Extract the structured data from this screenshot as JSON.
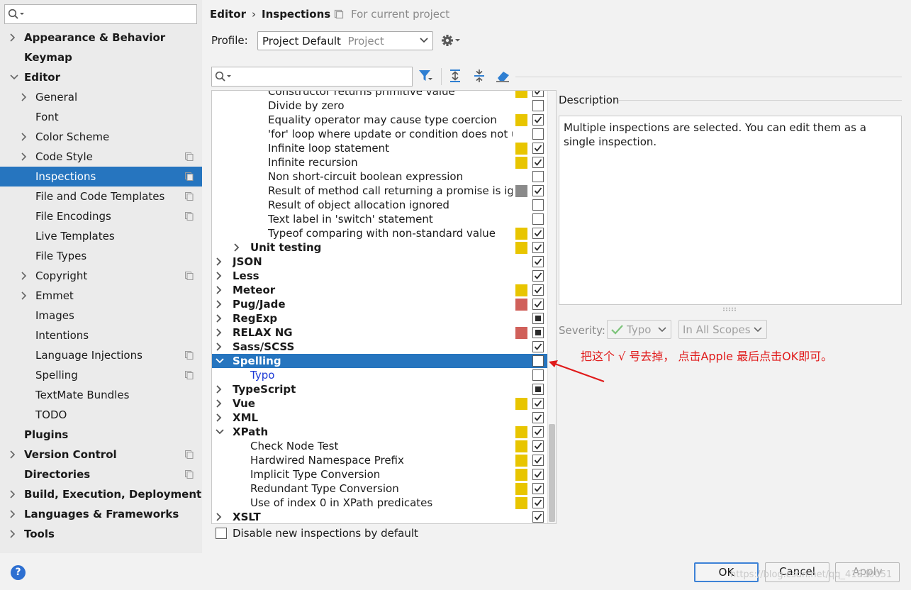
{
  "sidebar": {
    "search": {
      "value": "",
      "placeholder": ""
    },
    "items": [
      {
        "label": "Appearance & Behavior",
        "level": 0,
        "bold": true,
        "expander": "collapsed",
        "proj": false,
        "selected": false
      },
      {
        "label": "Keymap",
        "level": 0,
        "bold": true,
        "expander": "none",
        "proj": false,
        "selected": false
      },
      {
        "label": "Editor",
        "level": 0,
        "bold": true,
        "expander": "expanded",
        "proj": false,
        "selected": false
      },
      {
        "label": "General",
        "level": 1,
        "bold": false,
        "expander": "collapsed",
        "proj": false,
        "selected": false
      },
      {
        "label": "Font",
        "level": 1,
        "bold": false,
        "expander": "none",
        "proj": false,
        "selected": false
      },
      {
        "label": "Color Scheme",
        "level": 1,
        "bold": false,
        "expander": "collapsed",
        "proj": false,
        "selected": false
      },
      {
        "label": "Code Style",
        "level": 1,
        "bold": false,
        "expander": "collapsed",
        "proj": true,
        "selected": false
      },
      {
        "label": "Inspections",
        "level": 1,
        "bold": false,
        "expander": "none",
        "proj": true,
        "selected": true
      },
      {
        "label": "File and Code Templates",
        "level": 1,
        "bold": false,
        "expander": "none",
        "proj": true,
        "selected": false
      },
      {
        "label": "File Encodings",
        "level": 1,
        "bold": false,
        "expander": "none",
        "proj": true,
        "selected": false
      },
      {
        "label": "Live Templates",
        "level": 1,
        "bold": false,
        "expander": "none",
        "proj": false,
        "selected": false
      },
      {
        "label": "File Types",
        "level": 1,
        "bold": false,
        "expander": "none",
        "proj": false,
        "selected": false
      },
      {
        "label": "Copyright",
        "level": 1,
        "bold": false,
        "expander": "collapsed",
        "proj": true,
        "selected": false
      },
      {
        "label": "Emmet",
        "level": 1,
        "bold": false,
        "expander": "collapsed",
        "proj": false,
        "selected": false
      },
      {
        "label": "Images",
        "level": 1,
        "bold": false,
        "expander": "none",
        "proj": false,
        "selected": false
      },
      {
        "label": "Intentions",
        "level": 1,
        "bold": false,
        "expander": "none",
        "proj": false,
        "selected": false
      },
      {
        "label": "Language Injections",
        "level": 1,
        "bold": false,
        "expander": "none",
        "proj": true,
        "selected": false
      },
      {
        "label": "Spelling",
        "level": 1,
        "bold": false,
        "expander": "none",
        "proj": true,
        "selected": false
      },
      {
        "label": "TextMate Bundles",
        "level": 1,
        "bold": false,
        "expander": "none",
        "proj": false,
        "selected": false
      },
      {
        "label": "TODO",
        "level": 1,
        "bold": false,
        "expander": "none",
        "proj": false,
        "selected": false
      },
      {
        "label": "Plugins",
        "level": 0,
        "bold": true,
        "expander": "none",
        "proj": false,
        "selected": false
      },
      {
        "label": "Version Control",
        "level": 0,
        "bold": true,
        "expander": "collapsed",
        "proj": true,
        "selected": false
      },
      {
        "label": "Directories",
        "level": 0,
        "bold": true,
        "expander": "none",
        "proj": true,
        "selected": false
      },
      {
        "label": "Build, Execution, Deployment",
        "level": 0,
        "bold": true,
        "expander": "collapsed",
        "proj": false,
        "selected": false
      },
      {
        "label": "Languages & Frameworks",
        "level": 0,
        "bold": true,
        "expander": "collapsed",
        "proj": false,
        "selected": false
      },
      {
        "label": "Tools",
        "level": 0,
        "bold": true,
        "expander": "collapsed",
        "proj": false,
        "selected": false
      }
    ]
  },
  "header": {
    "crumb1": "Editor",
    "separator": "›",
    "crumb2": "Inspections",
    "scope_note": "For current project",
    "profile_label": "Profile:",
    "profile_value": "Project Default",
    "profile_sub": "Project"
  },
  "filter": {
    "search_value": "",
    "search_placeholder": ""
  },
  "colors": {
    "selection": "#2675bf",
    "warning": "#e8c500",
    "error": "#d0605a",
    "weak_warning": "#8a8a8a",
    "annotation": "#e01a1a",
    "link": "#1c3ad6"
  },
  "tree": {
    "rows": [
      {
        "label": "Constructor returns primitive value",
        "level": 3,
        "bold": false,
        "expander": "none",
        "severity": "warning",
        "check": "checked",
        "selected": false,
        "link": false
      },
      {
        "label": "Divide by zero",
        "level": 3,
        "bold": false,
        "expander": "none",
        "severity": "none",
        "check": "unchecked",
        "selected": false,
        "link": false
      },
      {
        "label": "Equality operator may cause type coercion",
        "level": 3,
        "bold": false,
        "expander": "none",
        "severity": "warning",
        "check": "checked",
        "selected": false,
        "link": false
      },
      {
        "label": "'for' loop where update or condition does not use loop variable",
        "level": 3,
        "bold": false,
        "expander": "none",
        "severity": "none",
        "check": "unchecked",
        "selected": false,
        "link": false
      },
      {
        "label": "Infinite loop statement",
        "level": 3,
        "bold": false,
        "expander": "none",
        "severity": "warning",
        "check": "checked",
        "selected": false,
        "link": false
      },
      {
        "label": "Infinite recursion",
        "level": 3,
        "bold": false,
        "expander": "none",
        "severity": "warning",
        "check": "checked",
        "selected": false,
        "link": false
      },
      {
        "label": "Non short-circuit boolean expression",
        "level": 3,
        "bold": false,
        "expander": "none",
        "severity": "none",
        "check": "unchecked",
        "selected": false,
        "link": false
      },
      {
        "label": "Result of method call returning a promise is ignored",
        "level": 3,
        "bold": false,
        "expander": "none",
        "severity": "weak",
        "check": "checked",
        "selected": false,
        "link": false
      },
      {
        "label": "Result of object allocation ignored",
        "level": 3,
        "bold": false,
        "expander": "none",
        "severity": "none",
        "check": "unchecked",
        "selected": false,
        "link": false
      },
      {
        "label": "Text label in 'switch' statement",
        "level": 3,
        "bold": false,
        "expander": "none",
        "severity": "none",
        "check": "unchecked",
        "selected": false,
        "link": false
      },
      {
        "label": "Typeof comparing with non-standard value",
        "level": 3,
        "bold": false,
        "expander": "none",
        "severity": "warning",
        "check": "checked",
        "selected": false,
        "link": false
      },
      {
        "label": "Unit testing",
        "level": 2,
        "bold": true,
        "expander": "collapsed",
        "severity": "warning",
        "check": "checked",
        "selected": false,
        "link": false
      },
      {
        "label": "JSON",
        "level": 1,
        "bold": true,
        "expander": "collapsed",
        "severity": "none",
        "check": "checked",
        "selected": false,
        "link": false
      },
      {
        "label": "Less",
        "level": 1,
        "bold": true,
        "expander": "collapsed",
        "severity": "none",
        "check": "checked",
        "selected": false,
        "link": false
      },
      {
        "label": "Meteor",
        "level": 1,
        "bold": true,
        "expander": "collapsed",
        "severity": "warning",
        "check": "checked",
        "selected": false,
        "link": false
      },
      {
        "label": "Pug/Jade",
        "level": 1,
        "bold": true,
        "expander": "collapsed",
        "severity": "error",
        "check": "checked",
        "selected": false,
        "link": false
      },
      {
        "label": "RegExp",
        "level": 1,
        "bold": true,
        "expander": "collapsed",
        "severity": "none",
        "check": "mixed",
        "selected": false,
        "link": false
      },
      {
        "label": "RELAX NG",
        "level": 1,
        "bold": true,
        "expander": "collapsed",
        "severity": "error",
        "check": "mixed",
        "selected": false,
        "link": false
      },
      {
        "label": "Sass/SCSS",
        "level": 1,
        "bold": true,
        "expander": "collapsed",
        "severity": "none",
        "check": "checked",
        "selected": false,
        "link": false
      },
      {
        "label": "Spelling",
        "level": 1,
        "bold": true,
        "expander": "expanded",
        "severity": "none",
        "check": "unchecked",
        "selected": true,
        "link": false
      },
      {
        "label": "Typo",
        "level": 2,
        "bold": false,
        "expander": "none",
        "severity": "none",
        "check": "unchecked",
        "selected": false,
        "link": true
      },
      {
        "label": "TypeScript",
        "level": 1,
        "bold": true,
        "expander": "collapsed",
        "severity": "none",
        "check": "mixed",
        "selected": false,
        "link": false
      },
      {
        "label": "Vue",
        "level": 1,
        "bold": true,
        "expander": "collapsed",
        "severity": "warning",
        "check": "checked",
        "selected": false,
        "link": false
      },
      {
        "label": "XML",
        "level": 1,
        "bold": true,
        "expander": "collapsed",
        "severity": "none",
        "check": "checked",
        "selected": false,
        "link": false
      },
      {
        "label": "XPath",
        "level": 1,
        "bold": true,
        "expander": "expanded",
        "severity": "warning",
        "check": "checked",
        "selected": false,
        "link": false
      },
      {
        "label": "Check Node Test",
        "level": 2,
        "bold": false,
        "expander": "none",
        "severity": "warning",
        "check": "checked",
        "selected": false,
        "link": false
      },
      {
        "label": "Hardwired Namespace Prefix",
        "level": 2,
        "bold": false,
        "expander": "none",
        "severity": "warning",
        "check": "checked",
        "selected": false,
        "link": false
      },
      {
        "label": "Implicit Type Conversion",
        "level": 2,
        "bold": false,
        "expander": "none",
        "severity": "warning",
        "check": "checked",
        "selected": false,
        "link": false
      },
      {
        "label": "Redundant Type Conversion",
        "level": 2,
        "bold": false,
        "expander": "none",
        "severity": "warning",
        "check": "checked",
        "selected": false,
        "link": false
      },
      {
        "label": "Use of index 0 in XPath predicates",
        "level": 2,
        "bold": false,
        "expander": "none",
        "severity": "warning",
        "check": "checked",
        "selected": false,
        "link": false
      },
      {
        "label": "XSLT",
        "level": 1,
        "bold": true,
        "expander": "collapsed",
        "severity": "none",
        "check": "checked",
        "selected": false,
        "link": false
      }
    ],
    "disable_new_label": "Disable new inspections by default",
    "disable_new_checked": false
  },
  "description": {
    "title": "Description",
    "text": "Multiple inspections are selected. You can edit them as a single inspection."
  },
  "severity": {
    "label": "Severity:",
    "value": "Typo",
    "scope": "In All Scopes"
  },
  "annotation": {
    "text": "把这个 √ 号去掉， 点击Apple 最后点击OK即可。"
  },
  "footer": {
    "help": "?",
    "ok": "OK",
    "cancel": "Cancel",
    "apply": "Apply",
    "watermark": "https://blog.csdn.net/qq_41830051"
  }
}
